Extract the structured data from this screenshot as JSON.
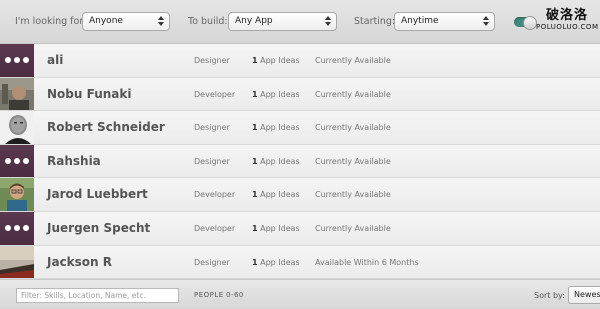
{
  "filters": {
    "looking_for_label": "I'm looking for:",
    "looking_for_value": "Anyone",
    "to_build_label": "To build:",
    "to_build_value": "Any App",
    "starting_label": "Starting:",
    "starting_value": "Anytime"
  },
  "watermark": {
    "line1": "破洛洛",
    "line2": "POLUOLUO.COM"
  },
  "people": [
    {
      "name": "ali",
      "role": "Designer",
      "ideas_count": "1",
      "ideas_label": "App Ideas",
      "availability": "Currently Available",
      "avatar": "dots"
    },
    {
      "name": "Nobu Funaki",
      "role": "Developer",
      "ideas_count": "1",
      "ideas_label": "App Ideas",
      "availability": "Currently Available",
      "avatar": "photo"
    },
    {
      "name": "Robert Schneider",
      "role": "Designer",
      "ideas_count": "1",
      "ideas_label": "App Ideas",
      "availability": "Currently Available",
      "avatar": "photo"
    },
    {
      "name": "Rahshia",
      "role": "Designer",
      "ideas_count": "1",
      "ideas_label": "App Ideas",
      "availability": "Currently Available",
      "avatar": "dots"
    },
    {
      "name": "Jarod Luebbert",
      "role": "Developer",
      "ideas_count": "1",
      "ideas_label": "App Ideas",
      "availability": "Currently Available",
      "avatar": "photo"
    },
    {
      "name": "Juergen Specht",
      "role": "Developer",
      "ideas_count": "1",
      "ideas_label": "App Ideas",
      "availability": "Currently Available",
      "avatar": "dots"
    },
    {
      "name": "Jackson R",
      "role": "Designer",
      "ideas_count": "1",
      "ideas_label": "App Ideas",
      "availability": "Available Within 6 Months",
      "avatar": "photo"
    }
  ],
  "footer": {
    "filter_placeholder": "Filter: Skills, Location, Name, etc.",
    "people_label": "PEOPLE",
    "range": "0-60",
    "sort_label": "Sort by:",
    "sort_value": "Newest"
  },
  "colors": {
    "avatar_placeholder": "#5b3a50",
    "toggle_on": "#3f8c7c"
  }
}
